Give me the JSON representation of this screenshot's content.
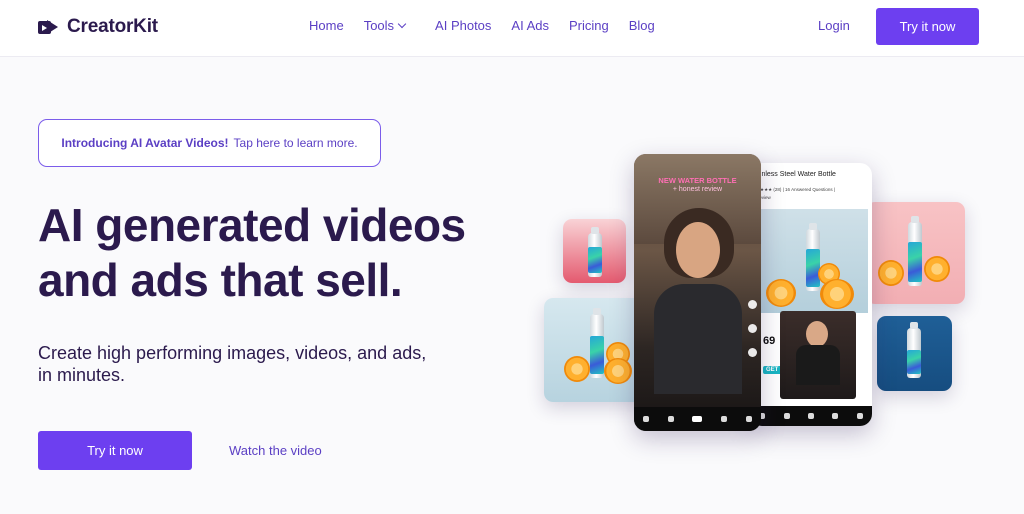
{
  "brand": {
    "name": "CreatorKit"
  },
  "nav": {
    "home": "Home",
    "tools": "Tools",
    "ai_photos": "AI Photos",
    "ai_ads": "AI Ads",
    "pricing": "Pricing",
    "blog": "Blog",
    "login": "Login",
    "cta": "Try it now"
  },
  "hero": {
    "announce_bold": "Introducing AI Avatar Videos!",
    "announce_link": "Tap here to learn more.",
    "headline_line1": "AI generated videos",
    "headline_line2": "and ads that sell.",
    "sub_line1": "Create high performing images, videos, and ads,",
    "sub_line2": "in minutes.",
    "cta": "Try it now",
    "watch": "Watch the video"
  },
  "collage": {
    "phone1_overlay_line1": "NEW WATER BOTTLE",
    "phone1_overlay_line2": "+ honest review",
    "phone2_title": "ainless Steel Water Bottle",
    "phone2_rating": "★★★★ (28) | 16 Answered Questions |",
    "phone2_review": "Review",
    "phone2_price": "69",
    "phone2_get": "GET 1",
    "colors": {
      "accent": "#6d3ff0",
      "text_dark": "#2b1a4d",
      "link": "#5b3fc4",
      "tile_pink": "#f7c6c7",
      "tile_blue": "#1f5f97",
      "tile_sky": "#cfe2ec"
    }
  }
}
